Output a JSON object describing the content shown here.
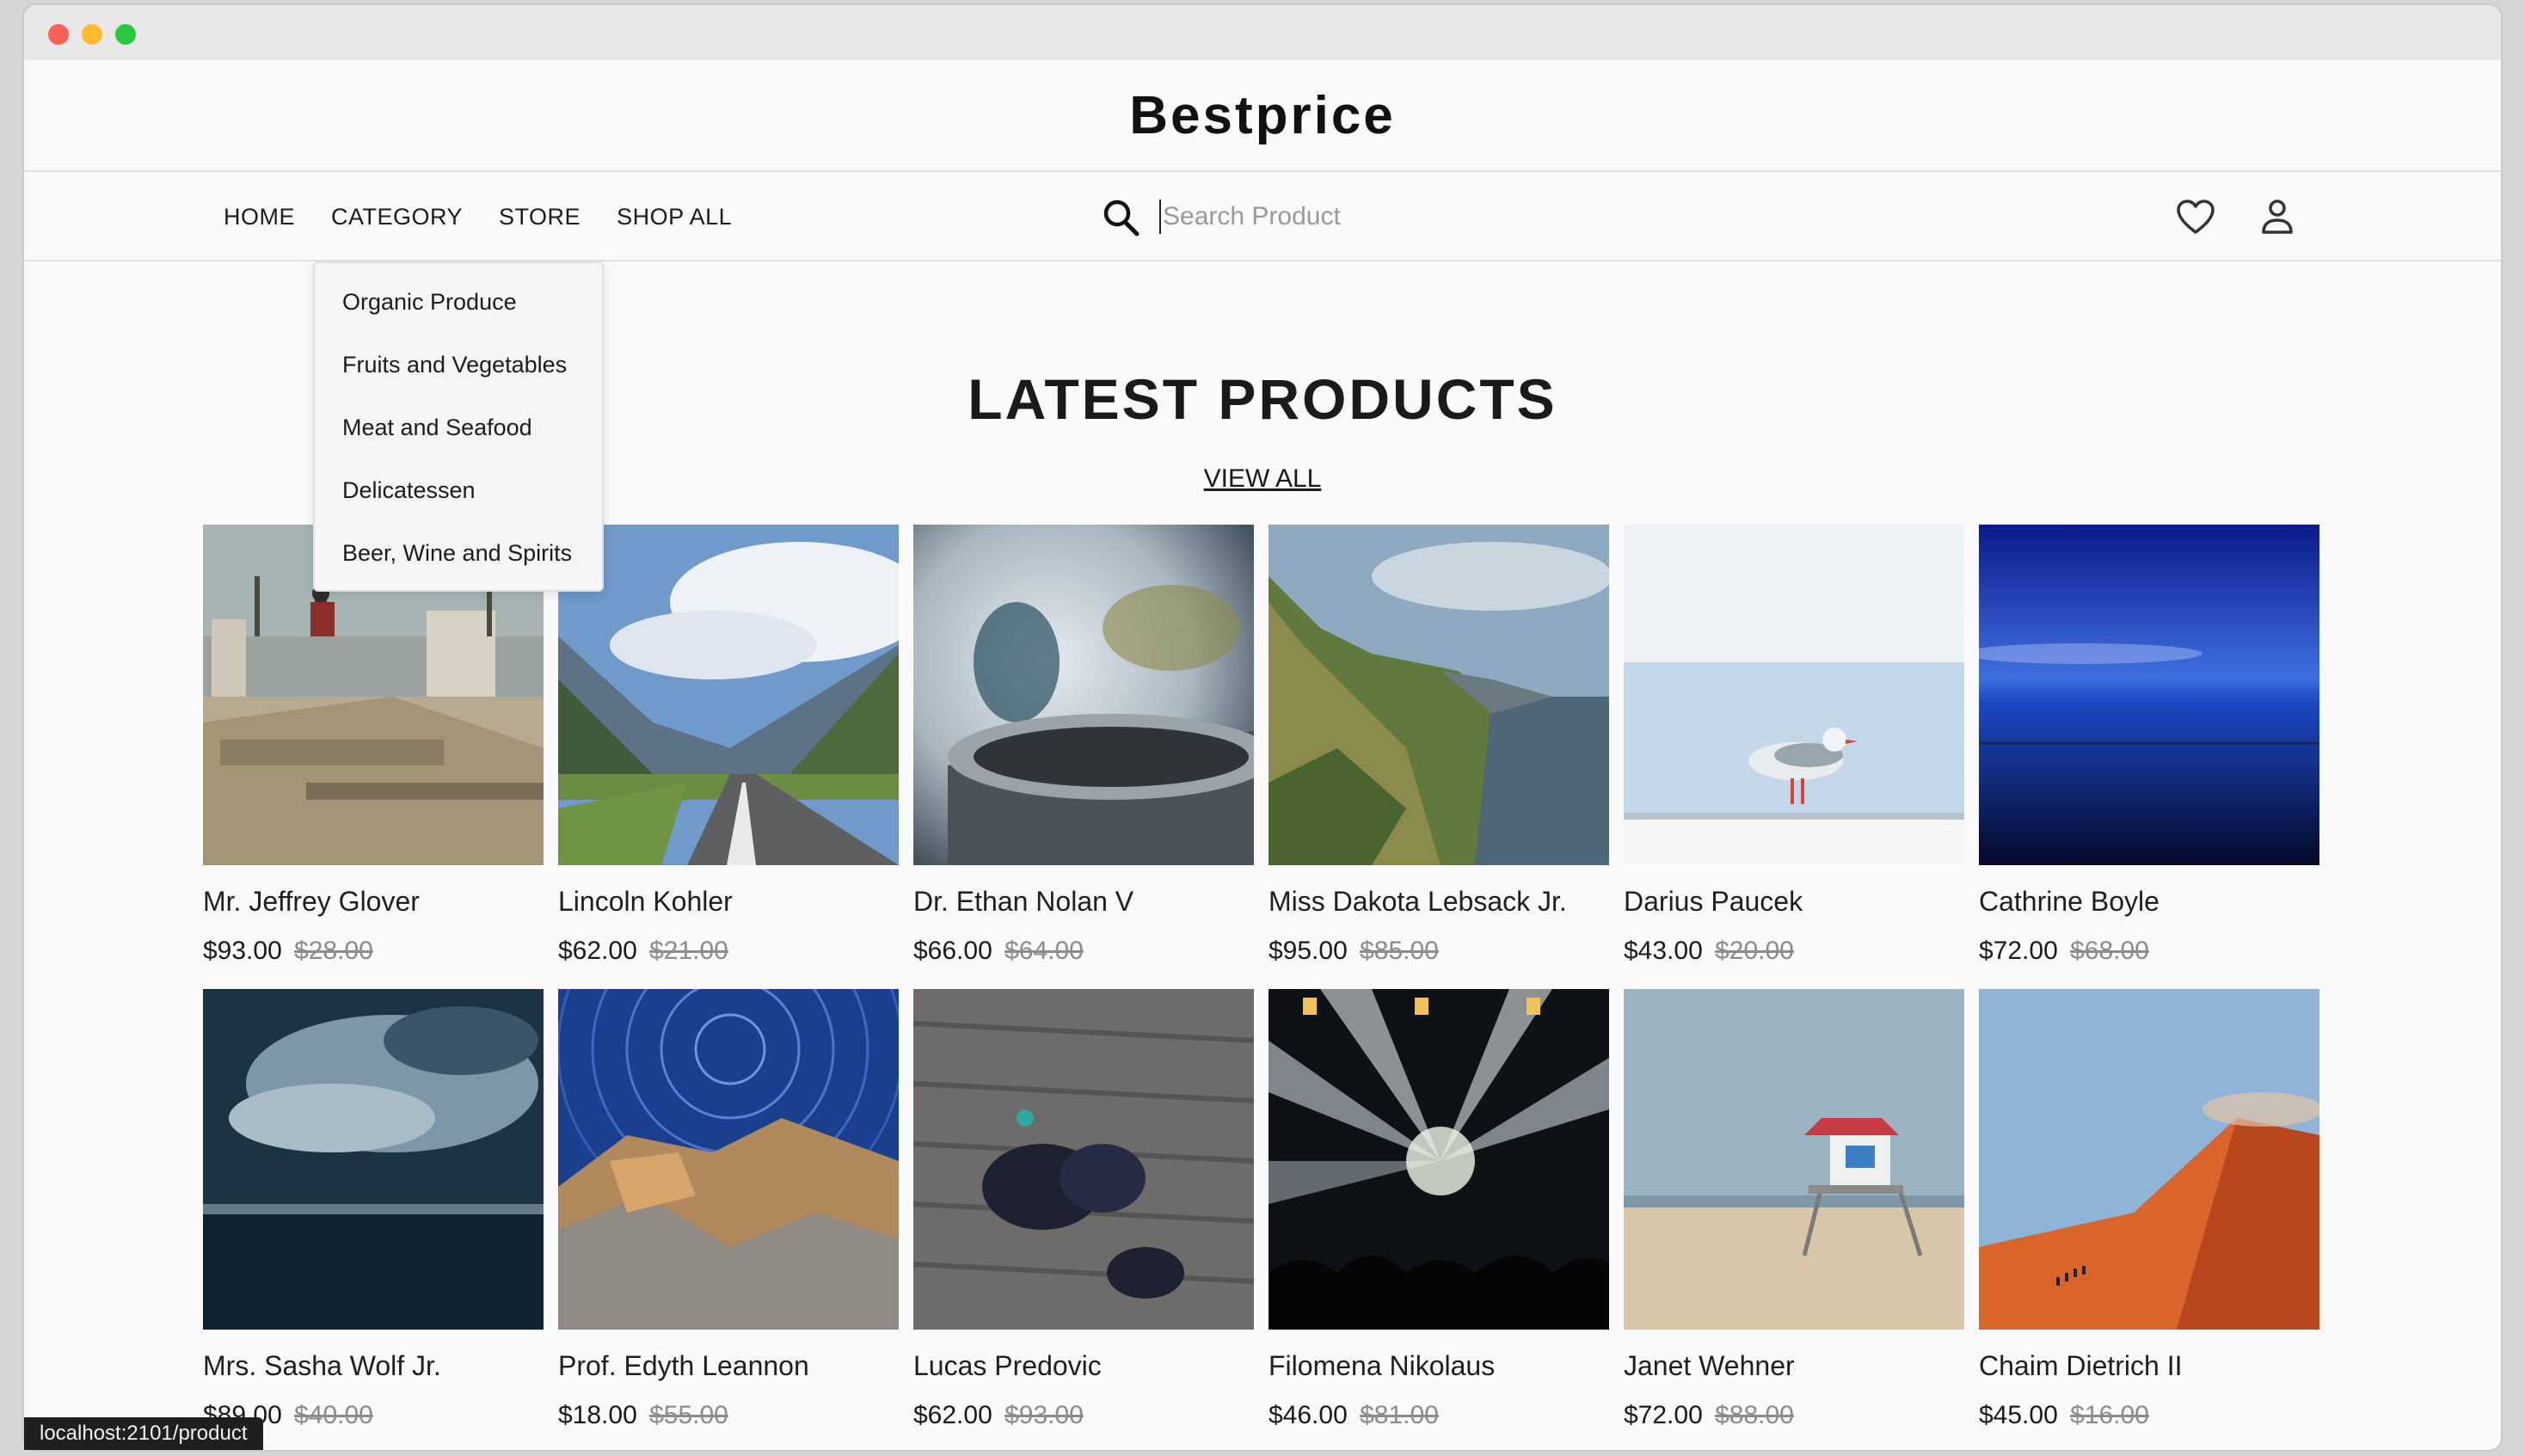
{
  "brand": "Bestprice",
  "nav": {
    "links": [
      "HOME",
      "CATEGORY",
      "STORE",
      "SHOP ALL"
    ]
  },
  "search": {
    "placeholder": "Search Product"
  },
  "category_menu": [
    "Organic Produce",
    "Fruits and Vegetables",
    "Meat and Seafood",
    "Delicatessen",
    "Beer, Wine and Spirits"
  ],
  "section": {
    "title": "LATEST PRODUCTS",
    "view_all": "VIEW ALL"
  },
  "products": [
    {
      "name": "Mr. Jeffrey Glover",
      "price": "$93.00",
      "old_price": "$28.00",
      "image": "skatepark"
    },
    {
      "name": "Lincoln Kohler",
      "price": "$62.00",
      "old_price": "$21.00",
      "image": "mountain-road"
    },
    {
      "name": "Dr. Ethan Nolan V",
      "price": "$66.00",
      "old_price": "$64.00",
      "image": "steaming-cup"
    },
    {
      "name": "Miss Dakota Lebsack Jr.",
      "price": "$95.00",
      "old_price": "$85.00",
      "image": "coastal-cliffs"
    },
    {
      "name": "Darius Paucek",
      "price": "$43.00",
      "old_price": "$20.00",
      "image": "seagull"
    },
    {
      "name": "Cathrine Boyle",
      "price": "$72.00",
      "old_price": "$68.00",
      "image": "blue-lake"
    },
    {
      "name": "Mrs. Sasha Wolf Jr.",
      "price": "$89.00",
      "old_price": "$40.00",
      "image": "stormy-sea"
    },
    {
      "name": "Prof. Edyth Leannon",
      "price": "$18.00",
      "old_price": "$55.00",
      "image": "star-trails"
    },
    {
      "name": "Lucas Predovic",
      "price": "$62.00",
      "old_price": "$93.00",
      "image": "people-on-dock"
    },
    {
      "name": "Filomena Nikolaus",
      "price": "$46.00",
      "old_price": "$81.00",
      "image": "concert-lights"
    },
    {
      "name": "Janet Wehner",
      "price": "$72.00",
      "old_price": "$88.00",
      "image": "lifeguard-tower"
    },
    {
      "name": "Chaim Dietrich II",
      "price": "$45.00",
      "old_price": "$16.00",
      "image": "sand-dune"
    }
  ],
  "status_url": "localhost:2101/product"
}
